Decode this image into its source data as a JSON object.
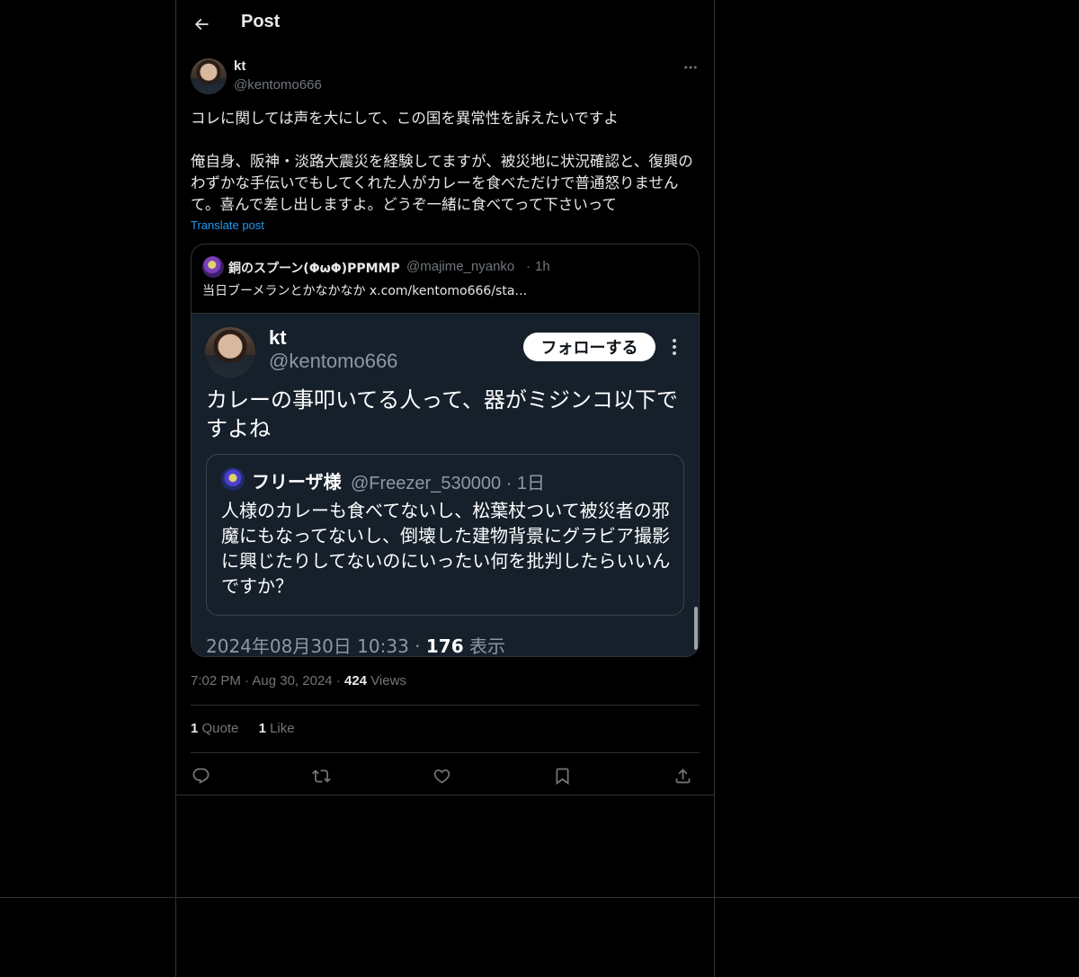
{
  "header": {
    "title": "Post"
  },
  "post": {
    "author_name": "kt",
    "author_handle": "@kentomo666",
    "text": "コレに関しては声を大にして、この国を異常性を訴えたいですよ\n\n俺自身、阪神・淡路大震災を経験してますが、被災地に状況確認と、復興のわずかな手伝いでもしてくれた人がカレーを食べただけで普通怒りませんて。喜んで差し出しますよ。どうぞ一緒に食べてって下さいって",
    "translate_label": "Translate post",
    "time": "7:02 PM",
    "date": "Aug 30, 2024",
    "views_count": "424",
    "views_label": "Views",
    "quotes_count": "1",
    "quotes_label": "Quote",
    "likes_count": "1",
    "likes_label": "Like"
  },
  "quote": {
    "name": "銅のスプーン(ΦωΦ)PPMMP",
    "handle": "@majime_nyanko",
    "time": "1h",
    "text": "当日ブーメランとかなかなか  x.com/kentomo666/sta…",
    "screenshot": {
      "name": "kt",
      "handle": "@kentomo666",
      "follow_label": "フォローする",
      "text": "カレーの事叩いてる人って、器がミジンコ以下ですよね",
      "inner_name": "フリーザ様",
      "inner_handle": "@Freezer_530000 · 1日",
      "inner_text": "人様のカレーも食べてないし、松葉杖ついて被災者の邪魔にもなってないし、倒壊した建物背景にグラビア撮影に興じたりしてないのにいったい何を批判したらいいんですか？",
      "date": "2024年08月30日 10:33 · ",
      "views_count": "176",
      "views_label": " 表示"
    }
  },
  "icons": {
    "back": "arrow-left-icon",
    "more": "more-horizontal-icon",
    "reply": "reply-icon",
    "repost": "repost-icon",
    "like": "heart-icon",
    "bookmark": "bookmark-icon",
    "share": "share-icon"
  },
  "colors": {
    "background": "#000000",
    "border": "#2f3336",
    "text": "#e7e9ea",
    "muted": "#71767b",
    "link": "#1d9bf0",
    "screenshot_bg": "#15202b"
  }
}
